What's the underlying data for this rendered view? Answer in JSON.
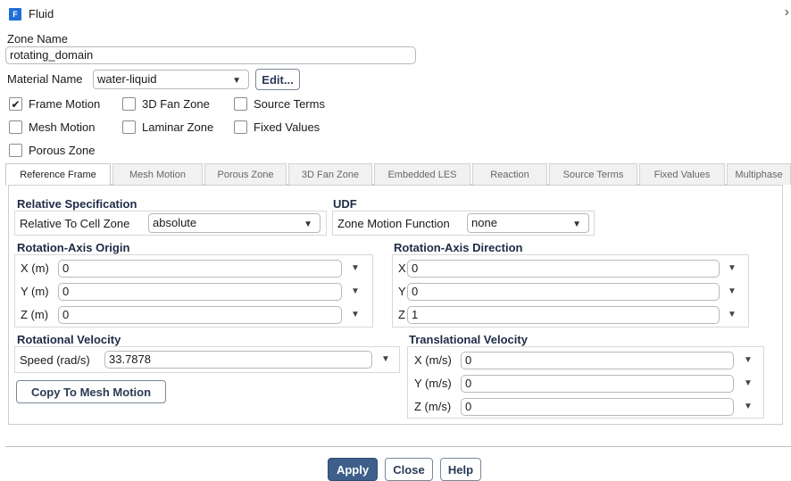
{
  "window": {
    "title": "Fluid",
    "icon": "fluent-app-icon",
    "close_glyph": "›"
  },
  "zone_name": {
    "label": "Zone Name",
    "value": "rotating_domain"
  },
  "material": {
    "label": "Material Name",
    "value": "water-liquid",
    "edit_label": "Edit..."
  },
  "options": {
    "frame_motion": {
      "label": "Frame Motion",
      "checked": true
    },
    "fan_zone_3d": {
      "label": "3D Fan Zone",
      "checked": false
    },
    "source_terms": {
      "label": "Source Terms",
      "checked": false
    },
    "mesh_motion": {
      "label": "Mesh Motion",
      "checked": false
    },
    "laminar_zone": {
      "label": "Laminar Zone",
      "checked": false
    },
    "fixed_values": {
      "label": "Fixed Values",
      "checked": false
    },
    "porous_zone": {
      "label": "Porous Zone",
      "checked": false
    }
  },
  "tabs": [
    "Reference Frame",
    "Mesh Motion",
    "Porous Zone",
    "3D Fan Zone",
    "Embedded LES",
    "Reaction",
    "Source Terms",
    "Fixed Values",
    "Multiphase"
  ],
  "active_tab": "Reference Frame",
  "relative_spec": {
    "title": "Relative Specification",
    "label": "Relative To Cell Zone",
    "value": "absolute"
  },
  "udf": {
    "title": "UDF",
    "label": "Zone Motion Function",
    "value": "none"
  },
  "axis_origin": {
    "title": "Rotation-Axis Origin",
    "x": {
      "label": "X (m)",
      "value": "0"
    },
    "y": {
      "label": "Y (m)",
      "value": "0"
    },
    "z": {
      "label": "Z (m)",
      "value": "0"
    }
  },
  "axis_direction": {
    "title": "Rotation-Axis Direction",
    "x": {
      "label": "X",
      "value": "0"
    },
    "y": {
      "label": "Y",
      "value": "0"
    },
    "z": {
      "label": "Z",
      "value": "1"
    }
  },
  "rotational_velocity": {
    "title": "Rotational Velocity",
    "label": "Speed (rad/s)",
    "value": "33.7878",
    "copy_label": "Copy To Mesh Motion"
  },
  "translational_velocity": {
    "title": "Translational Velocity",
    "x": {
      "label": "X (m/s)",
      "value": "0"
    },
    "y": {
      "label": "Y (m/s)",
      "value": "0"
    },
    "z": {
      "label": "Z (m/s)",
      "value": "0"
    }
  },
  "footer": {
    "apply": "Apply",
    "close": "Close",
    "help": "Help"
  },
  "glyphs": {
    "check": "✔",
    "dropdown_arrow": "▼"
  }
}
